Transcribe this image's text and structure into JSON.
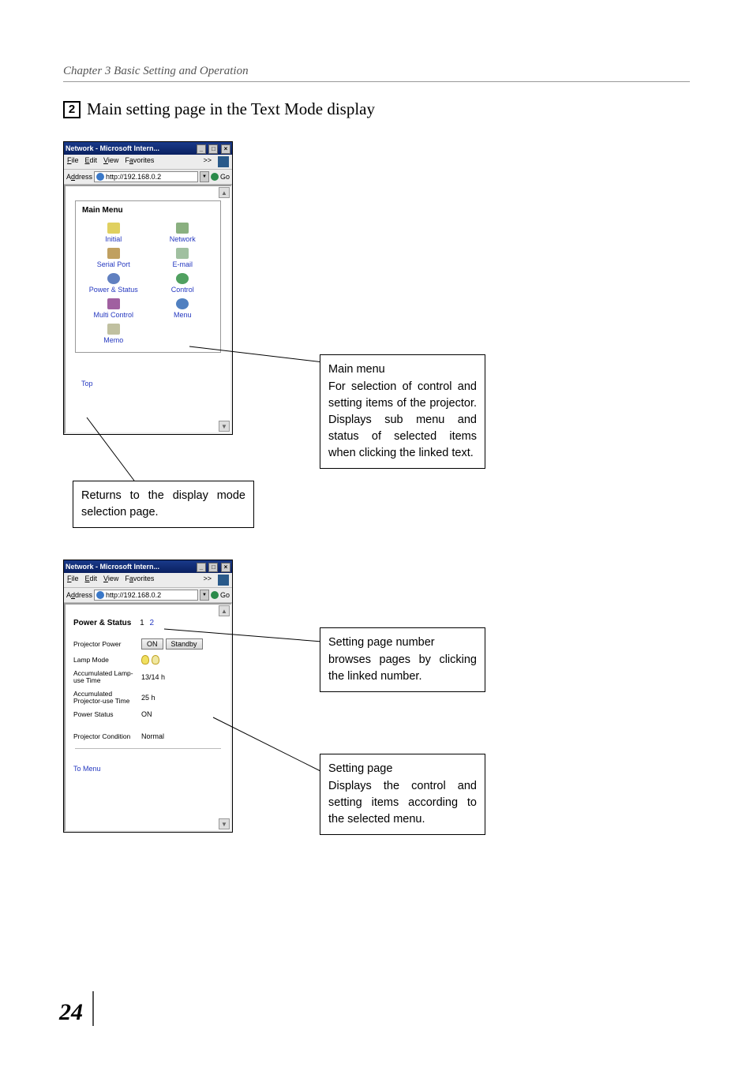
{
  "chapter_header": "Chapter 3 Basic Setting and Operation",
  "title_number": "2",
  "title_text": "Main setting page in the Text Mode display",
  "page_number": "24",
  "browser": {
    "title": "Network - Microsoft Intern...",
    "menu": {
      "file": "File",
      "edit": "Edit",
      "view": "View",
      "favorites": "Favorites",
      "more": ">>"
    },
    "address_label": "Address",
    "address_value": "http://192.168.0.2",
    "go": "Go"
  },
  "main_menu": {
    "heading": "Main Menu",
    "items": {
      "initial": "Initial",
      "network": "Network",
      "serial": "Serial Port",
      "email": "E-mail",
      "power": "Power & Status",
      "control": "Control",
      "multi": "Multi Control",
      "menu": "Menu",
      "memo": "Memo"
    },
    "top": "Top"
  },
  "status": {
    "heading": "Power & Status",
    "page1": "1",
    "page2": "2",
    "rows": {
      "power_label": "Projector Power",
      "on_btn": "ON",
      "standby_btn": "Standby",
      "lamp_mode": "Lamp Mode",
      "acc_lamp_label": "Accumulated Lamp-use Time",
      "acc_lamp_val": "13/14 h",
      "acc_proj_label": "Accumulated Projector-use Time",
      "acc_proj_val": "25 h",
      "pstatus_label": "Power Status",
      "pstatus_val": "ON",
      "cond_label": "Projector Condition",
      "cond_val": "Normal"
    },
    "to_menu": "To Menu"
  },
  "callouts": {
    "main_menu_hdr": "Main menu",
    "main_menu_body": "For selection of  control and setting items of the projector. Displays sub menu and status of selected items when clicking the linked text.",
    "returns": "Returns to the display mode selection page.",
    "setting_num_hdr": "Setting page number",
    "setting_num_body": "browses pages by clicking the linked number.",
    "setting_page_hdr": "Setting page",
    "setting_page_body": "Displays the control and setting items according to the selected menu."
  }
}
